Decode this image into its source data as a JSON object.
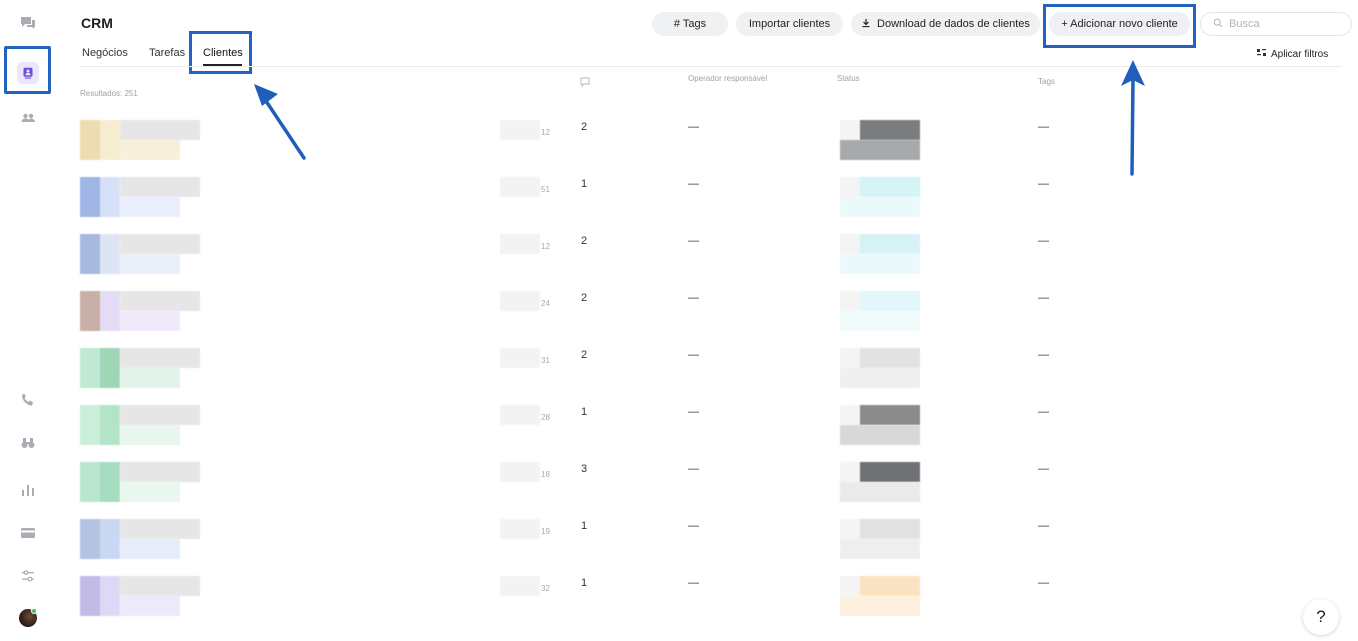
{
  "header": {
    "title": "CRM",
    "tabs": [
      {
        "label": "Negócios"
      },
      {
        "label": "Tarefas"
      },
      {
        "label": "Clientes"
      }
    ],
    "buttons": {
      "tags": "# Tags",
      "import": "Importar clientes",
      "download": "Download de dados de clientes",
      "add": "+ Adicionar novo cliente"
    },
    "search_placeholder": "Busca",
    "filters_label": "Aplicar filtros"
  },
  "table": {
    "results": "Resultados: 251",
    "columns": {
      "operator": "Operador responsável",
      "status": "Status",
      "tags": "Tags"
    },
    "rows": [
      {
        "small": "12",
        "messages": "2",
        "operator": "—",
        "tags": "—"
      },
      {
        "small": "51",
        "messages": "1",
        "operator": "—",
        "tags": "—"
      },
      {
        "small": "12",
        "messages": "2",
        "operator": "—",
        "tags": "—"
      },
      {
        "small": "24",
        "messages": "2",
        "operator": "—",
        "tags": "—"
      },
      {
        "small": "31",
        "messages": "2",
        "operator": "—",
        "tags": "—"
      },
      {
        "small": "28",
        "messages": "1",
        "operator": "—",
        "tags": "—"
      },
      {
        "small": "18",
        "messages": "3",
        "operator": "—",
        "tags": "—"
      },
      {
        "small": "19",
        "messages": "1",
        "operator": "—",
        "tags": "—"
      },
      {
        "small": "32",
        "messages": "1",
        "operator": "—",
        "tags": "—"
      }
    ]
  },
  "sidebar": {
    "icons": [
      "chat-icon",
      "contacts-icon",
      "team-icon",
      "phone-icon",
      "binoculars-icon",
      "analytics-icon",
      "billing-icon",
      "settings-icon"
    ]
  },
  "help_label": "?",
  "colors": {
    "accent": "#6b4fd8",
    "highlight": "#2164c0"
  }
}
